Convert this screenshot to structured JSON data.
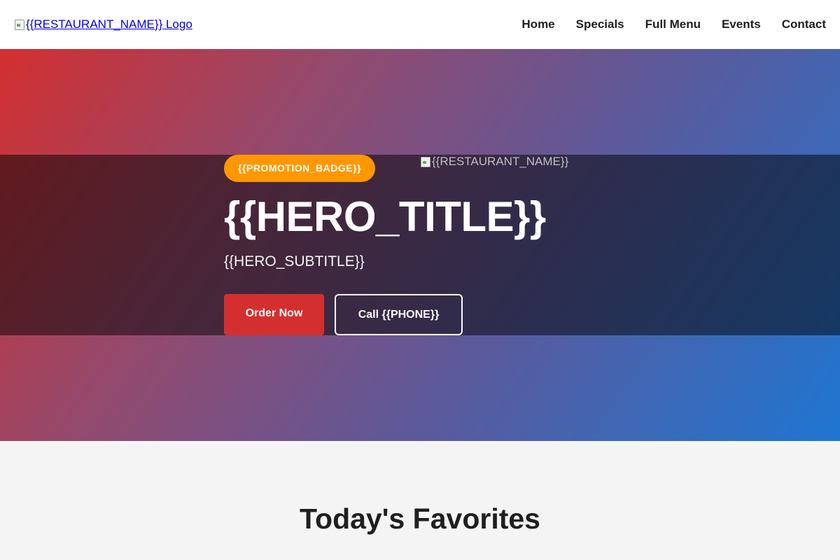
{
  "header": {
    "logo_alt": "{{RESTAURANT_NAME}} Logo",
    "nav": [
      {
        "label": "Home"
      },
      {
        "label": "Specials"
      },
      {
        "label": "Full Menu"
      },
      {
        "label": "Events"
      },
      {
        "label": "Contact"
      }
    ]
  },
  "hero": {
    "badge": "{{PROMOTION_BADGE}}",
    "image_alt": "{{RESTAURANT_NAME}}",
    "title": "{{HERO_TITLE}}",
    "subtitle": "{{HERO_SUBTITLE}}",
    "primary_button": "Order Now",
    "secondary_button": "Call {{PHONE}}"
  },
  "favorites": {
    "title": "Today's Favorites"
  },
  "colors": {
    "accent_red": "#d32f2f",
    "badge_orange": "#ff9800",
    "gradient_end_blue": "#1e76d2"
  }
}
